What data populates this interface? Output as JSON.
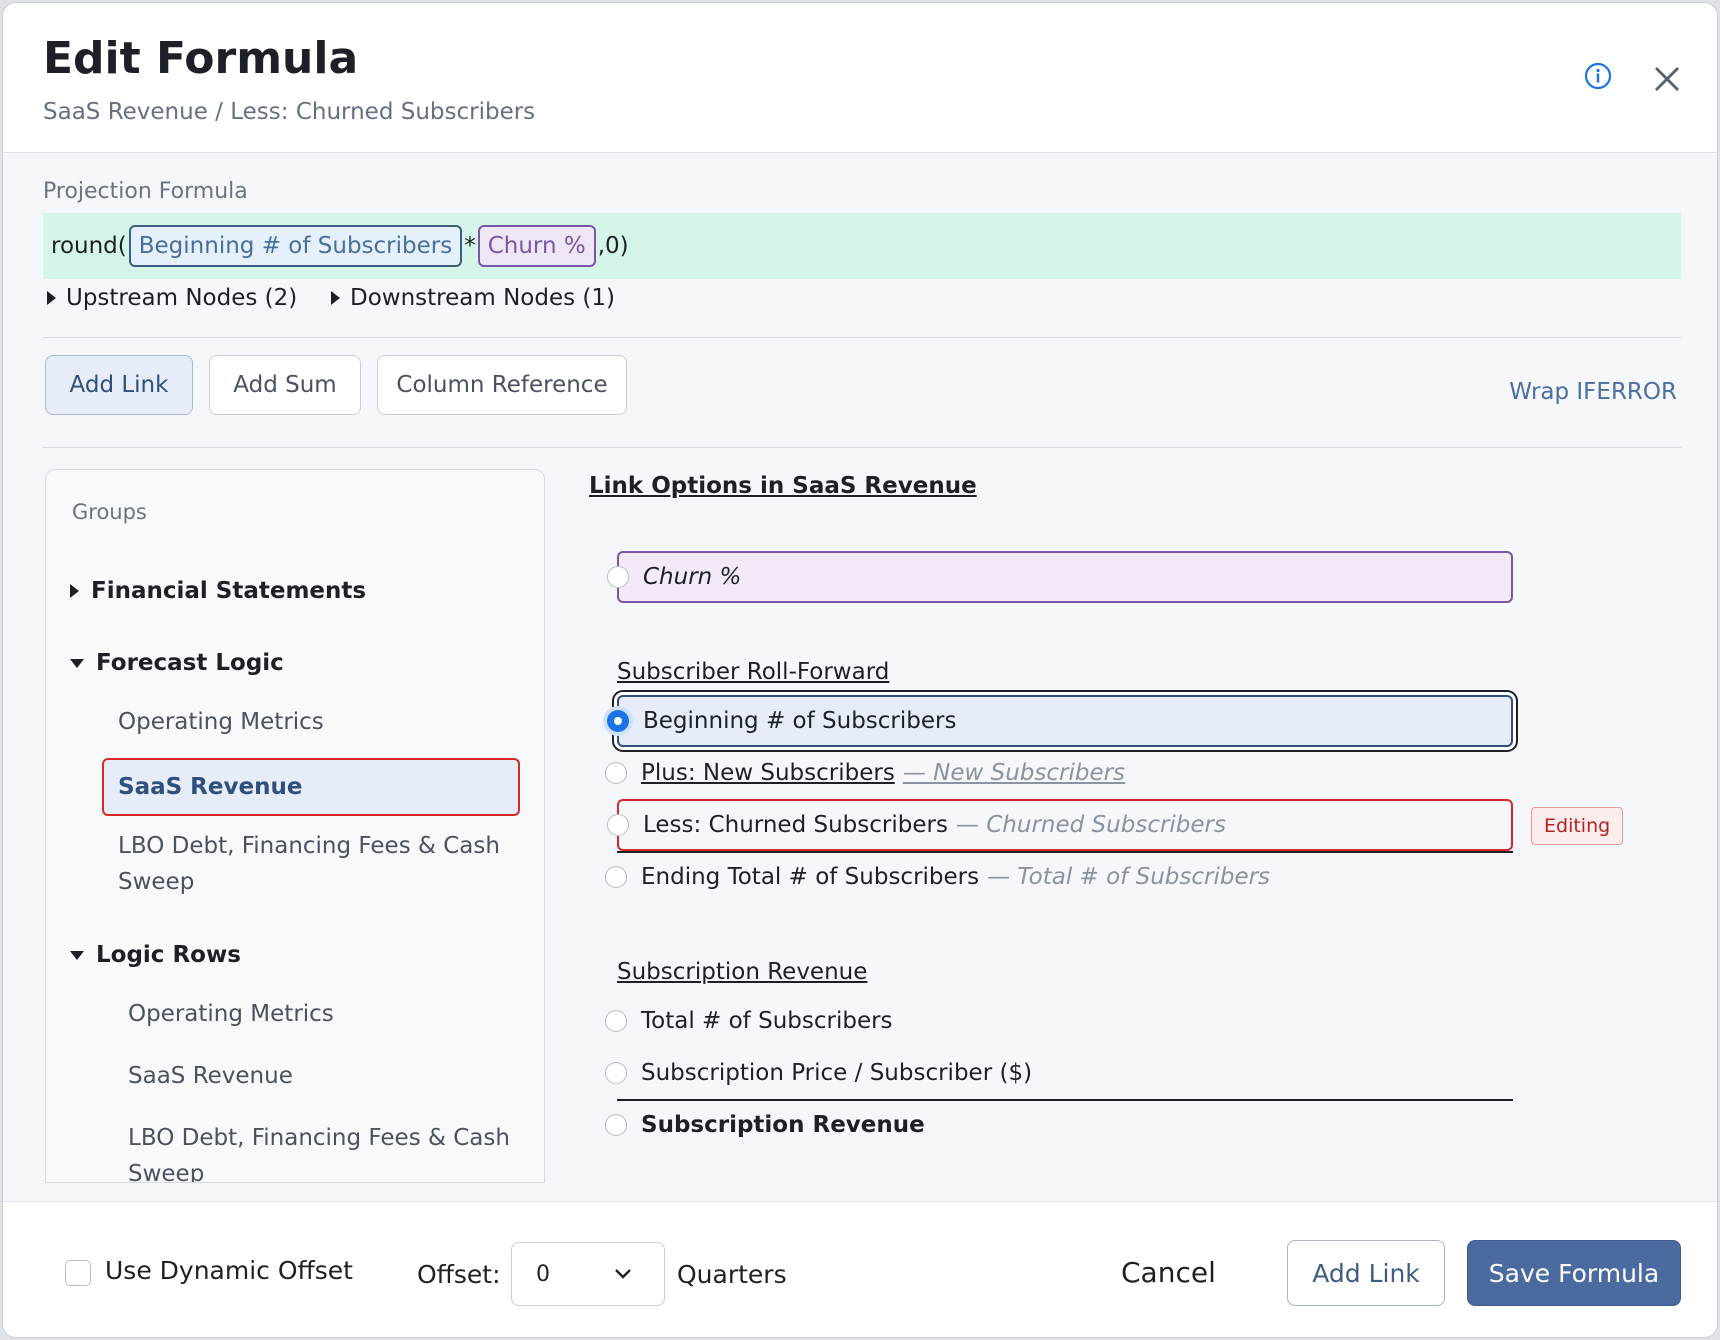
{
  "header": {
    "title": "Edit Formula",
    "breadcrumb": "SaaS Revenue / Less: Churned Subscribers",
    "info_icon": "info-icon",
    "close_icon": "close-icon"
  },
  "formula": {
    "label": "Projection Formula",
    "prefix": "round(",
    "chip1": "Beginning # of Subscribers",
    "operator": "*",
    "chip2": "Churn %",
    "suffix": ",0)",
    "upstream": "Upstream Nodes (2)",
    "downstream": "Downstream Nodes (1)"
  },
  "toolbar": {
    "add_link": "Add Link",
    "add_sum": "Add Sum",
    "column_reference": "Column Reference",
    "wrap_iferror": "Wrap IFERROR"
  },
  "groups": {
    "label": "Groups",
    "financial_statements": "Financial Statements",
    "forecast_logic": "Forecast Logic",
    "forecast_items": [
      "Operating Metrics",
      "SaaS Revenue",
      "LBO Debt, Financing Fees & Cash Sweep"
    ],
    "logic_rows": "Logic Rows",
    "logic_items": [
      "Operating Metrics",
      "SaaS Revenue",
      "LBO Debt, Financing Fees & Cash Sweep"
    ]
  },
  "link_options": {
    "title": "Link Options in SaaS Revenue",
    "churn": "Churn %",
    "section1": "Subscriber Roll-Forward",
    "beginning": "Beginning # of Subscribers",
    "plus_new": "Plus: New Subscribers",
    "plus_new_sub": "— New Subscribers",
    "less_churned": "Less: Churned Subscribers",
    "less_churned_sub": "— Churned Subscribers",
    "editing": "Editing",
    "ending": "Ending Total # of Subscribers",
    "ending_sub": "— Total # of Subscribers",
    "section2": "Subscription Revenue",
    "total_subs": "Total # of Subscribers",
    "price": "Subscription Price / Subscriber ($)",
    "sub_revenue": "Subscription Revenue"
  },
  "footer": {
    "dynamic_offset": "Use Dynamic Offset",
    "offset_label": "Offset:",
    "offset_value": "0",
    "quarters": "Quarters",
    "cancel": "Cancel",
    "add_link": "Add Link",
    "save": "Save Formula"
  },
  "colors": {
    "accent": "#4a6aa0",
    "formula_bg": "#d6f5e9",
    "editing_red": "#d62828",
    "radio_blue": "#1a73e8"
  }
}
